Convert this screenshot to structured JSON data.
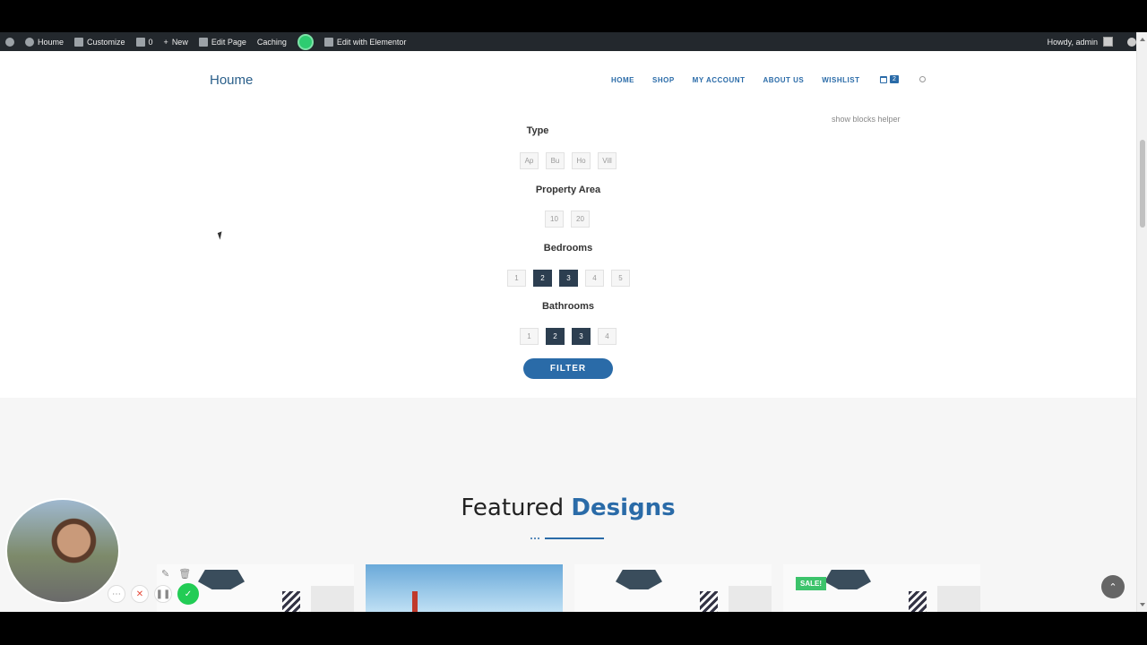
{
  "adminbar": {
    "items": [
      "Houme",
      "Customize",
      "0",
      "New",
      "Edit Page",
      "Caching",
      "Edit with Elementor"
    ],
    "greeting": "Howdy, admin"
  },
  "header": {
    "logo": "Houme",
    "nav": [
      "HOME",
      "SHOP",
      "MY ACCOUNT",
      "ABOUT US",
      "WISHLIST"
    ],
    "cart_count": "2"
  },
  "helper": "show blocks helper",
  "filter": {
    "type": {
      "title": "Type",
      "options": [
        "Ap",
        "Bu",
        "Ho",
        "Vill"
      ]
    },
    "area": {
      "title": "Property Area",
      "options": [
        "10",
        "20"
      ]
    },
    "bedrooms": {
      "title": "Bedrooms",
      "options": [
        "1",
        "2",
        "3",
        "4",
        "5"
      ],
      "active": [
        "2",
        "3"
      ]
    },
    "bathrooms": {
      "title": "Bathrooms",
      "options": [
        "1",
        "2",
        "3",
        "4"
      ],
      "active": [
        "2",
        "3"
      ]
    },
    "button": "FILTER"
  },
  "featured": {
    "title_plain": "Featured",
    "title_accent": "Designs",
    "sale_badge": "SALE!"
  },
  "colors": {
    "accent": "#2a6ba8",
    "active_chip": "#2c3e50",
    "sale": "#3cc36b"
  }
}
